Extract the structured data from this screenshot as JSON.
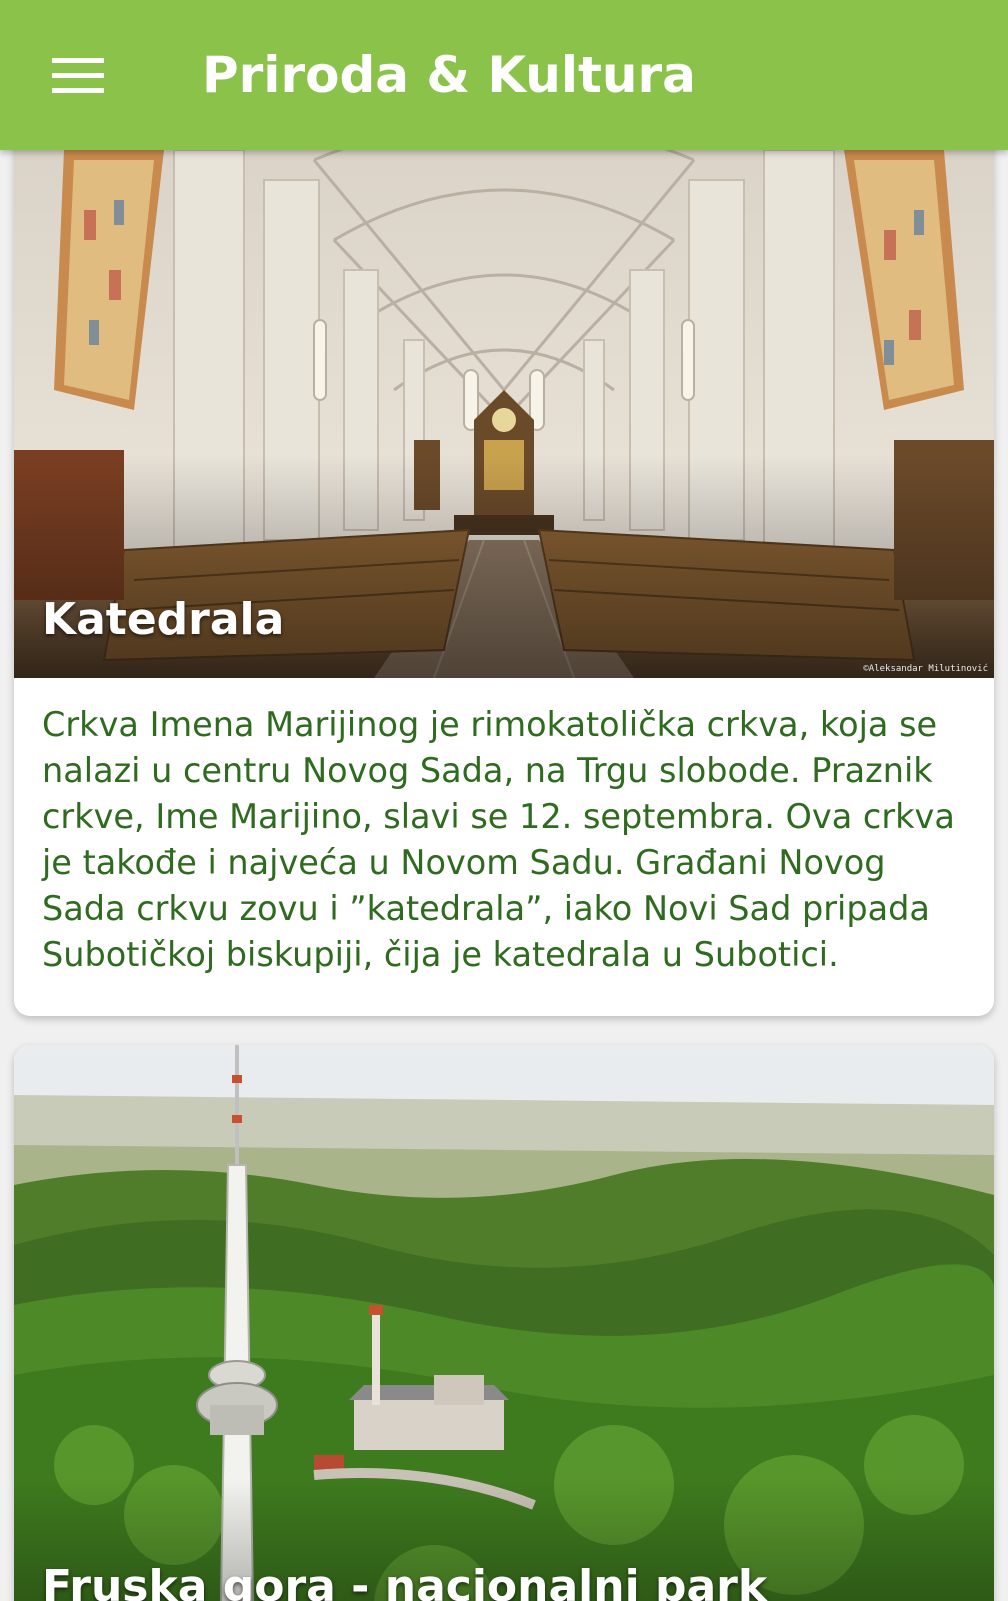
{
  "appbar": {
    "title": "Priroda & Kultura",
    "menu_icon": "hamburger-menu-icon",
    "background_color": "#8bc34a"
  },
  "cards": [
    {
      "title": "Katedrala",
      "image": "cathedral-interior-photo",
      "credit": "©Aleksandar Milutinović",
      "description": "Crkva Imena Marijinog je rimokatolička crkva, koja se nalazi u centru Novog Sada, na Trgu slobode. Praznik crkve, Ime Marijino, slavi se 12. septembra. Ova crkva je takođe i najveća u Novom Sadu. Građani Novog Sada crkvu zovu i ”katedrala”, iako Novi Sad pripada Subotičkoj biskupiji, čija je katedrala u Subotici."
    },
    {
      "title": "Fruska gora - nacionalni park",
      "image": "fruska-gora-aerial-photo"
    }
  ],
  "colors": {
    "accent": "#8bc34a",
    "description_text": "#2e6b1f",
    "card_background": "#ffffff"
  }
}
